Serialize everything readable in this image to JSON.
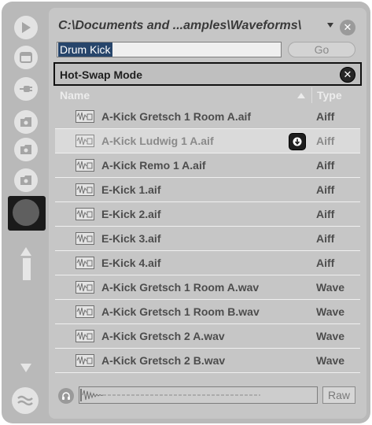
{
  "browser": {
    "path": "C:\\Documents and ...amples\\Waveforms\\",
    "search_value": "Drum Kick",
    "go_label": "Go",
    "close_symbol": "✕",
    "hotswap_label": "Hot-Swap Mode",
    "columns": {
      "name": "Name",
      "type": "Type"
    },
    "files": [
      {
        "name": "A-Kick Gretsch 1 Room A.aif",
        "type": "Aiff"
      },
      {
        "name": "A-Kick Ludwig 1 A.aif",
        "type": "Aiff"
      },
      {
        "name": "A-Kick Remo 1 A.aif",
        "type": "Aiff"
      },
      {
        "name": "E-Kick 1.aif",
        "type": "Aiff"
      },
      {
        "name": "E-Kick 2.aif",
        "type": "Aiff"
      },
      {
        "name": "E-Kick 3.aif",
        "type": "Aiff"
      },
      {
        "name": "E-Kick 4.aif",
        "type": "Aiff"
      },
      {
        "name": "A-Kick Gretsch 1 Room A.wav",
        "type": "Wave"
      },
      {
        "name": "A-Kick Gretsch 1 Room B.wav",
        "type": "Wave"
      },
      {
        "name": "A-Kick Gretsch 2 A.wav",
        "type": "Wave"
      },
      {
        "name": "A-Kick Gretsch 2 B.wav",
        "type": "Wave"
      }
    ],
    "raw_label": "Raw"
  },
  "sidebar": {
    "icons": [
      "play-icon",
      "window-icon",
      "plugin-icon",
      "folder-icon",
      "folder-icon",
      "folder-icon",
      "current-project-icon",
      "groove-icon"
    ]
  },
  "colors": {
    "accent_selection": "#27456b",
    "panel": "#c6c6c6",
    "hotswap_border": "#111111"
  }
}
